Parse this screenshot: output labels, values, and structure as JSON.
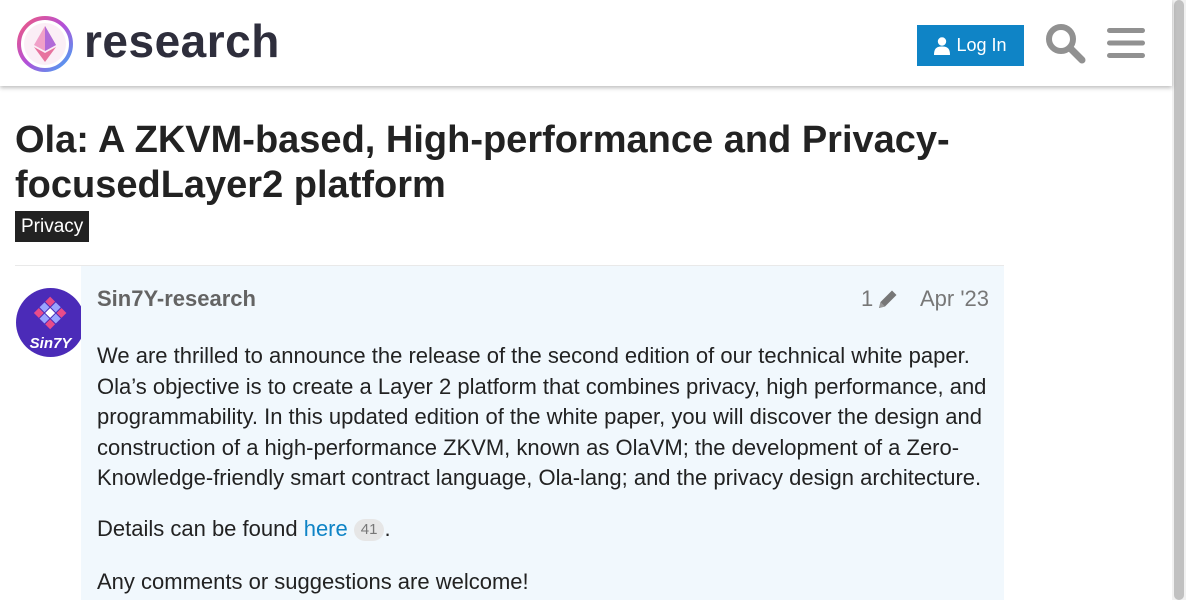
{
  "header": {
    "brand": "research",
    "login_label": "Log In",
    "icons": {
      "logo": "ethereum-research-logo",
      "login": "user-icon",
      "search": "search-icon",
      "menu": "hamburger-menu-icon"
    }
  },
  "topic": {
    "title": "Ola: A ZKVM-based, High-performance and Privacy-focusedLayer2 platform",
    "category": "Privacy"
  },
  "post": {
    "author": "Sin7Y-research",
    "avatar_text": "Sin7Y",
    "edit_count": "1",
    "date": "Apr '23",
    "paragraph1": "We are thrilled to announce the release of the second edition of our technical white paper. Ola’s objective is to create a Layer 2 platform that combines privacy, high performance, and programmability. In this updated edition of the white paper, you will discover the design and construction of a high-performance ZKVM, known as OlaVM; the development of a Zero-Knowledge-friendly smart contract language, Ola-lang; and the privacy design architecture.",
    "details_prefix": "Details can be found ",
    "details_link": "here",
    "link_clicks": "41",
    "details_suffix": ".",
    "paragraph3": "Any comments or suggestions are welcome!"
  },
  "colors": {
    "accent": "#0f84c6",
    "post_background": "#f1f8fd",
    "category_badge": "#222222"
  }
}
